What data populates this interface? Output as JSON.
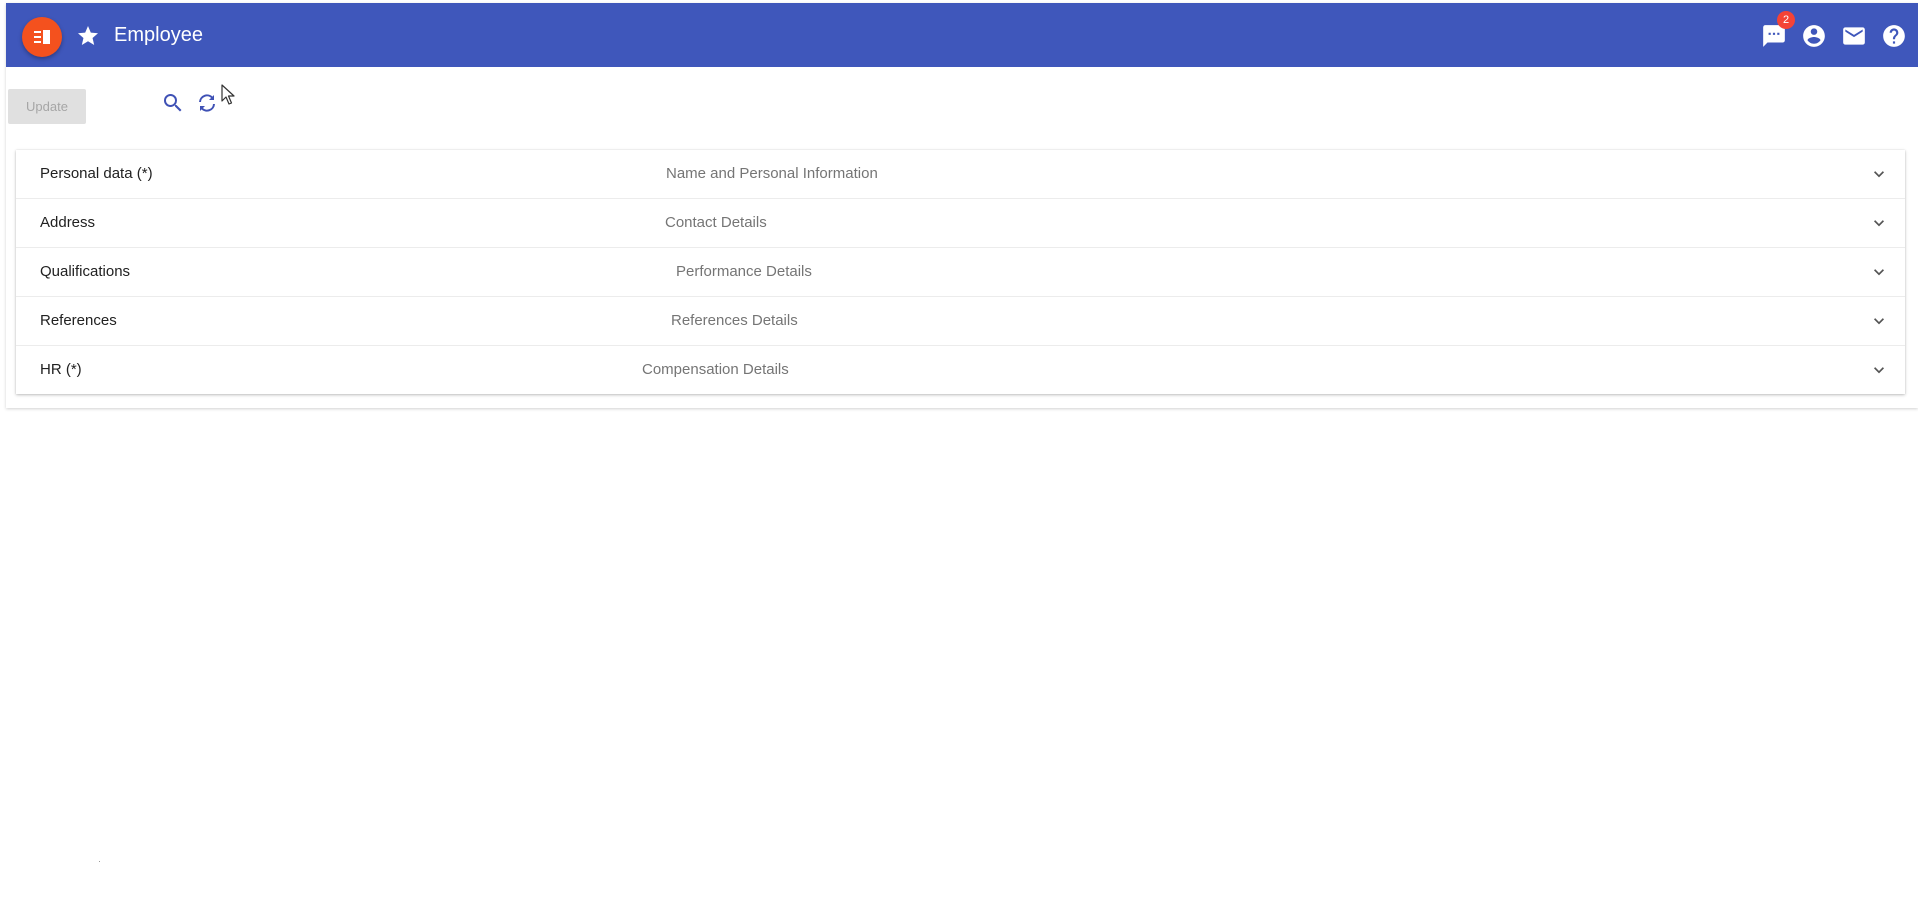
{
  "header": {
    "title": "Employee",
    "menu_icon": "menu-book-icon",
    "favorite_icon": "star-icon",
    "notifications_count": "2",
    "actions": [
      "chat-icon",
      "account-icon",
      "mail-icon",
      "help-icon"
    ],
    "color": "#3f57bb",
    "fab_color": "#f4511e"
  },
  "toolbar": {
    "update_label": "Update",
    "icons": [
      "search-icon",
      "refresh-icon"
    ]
  },
  "panels": [
    {
      "title": "Personal data (*)",
      "description": "Name and Personal Information"
    },
    {
      "title": "Address",
      "description": "Contact Details"
    },
    {
      "title": "Qualifications",
      "description": "Performance Details"
    },
    {
      "title": "References",
      "description": "References Details"
    },
    {
      "title": "HR (*)",
      "description": "Compensation Details"
    }
  ]
}
